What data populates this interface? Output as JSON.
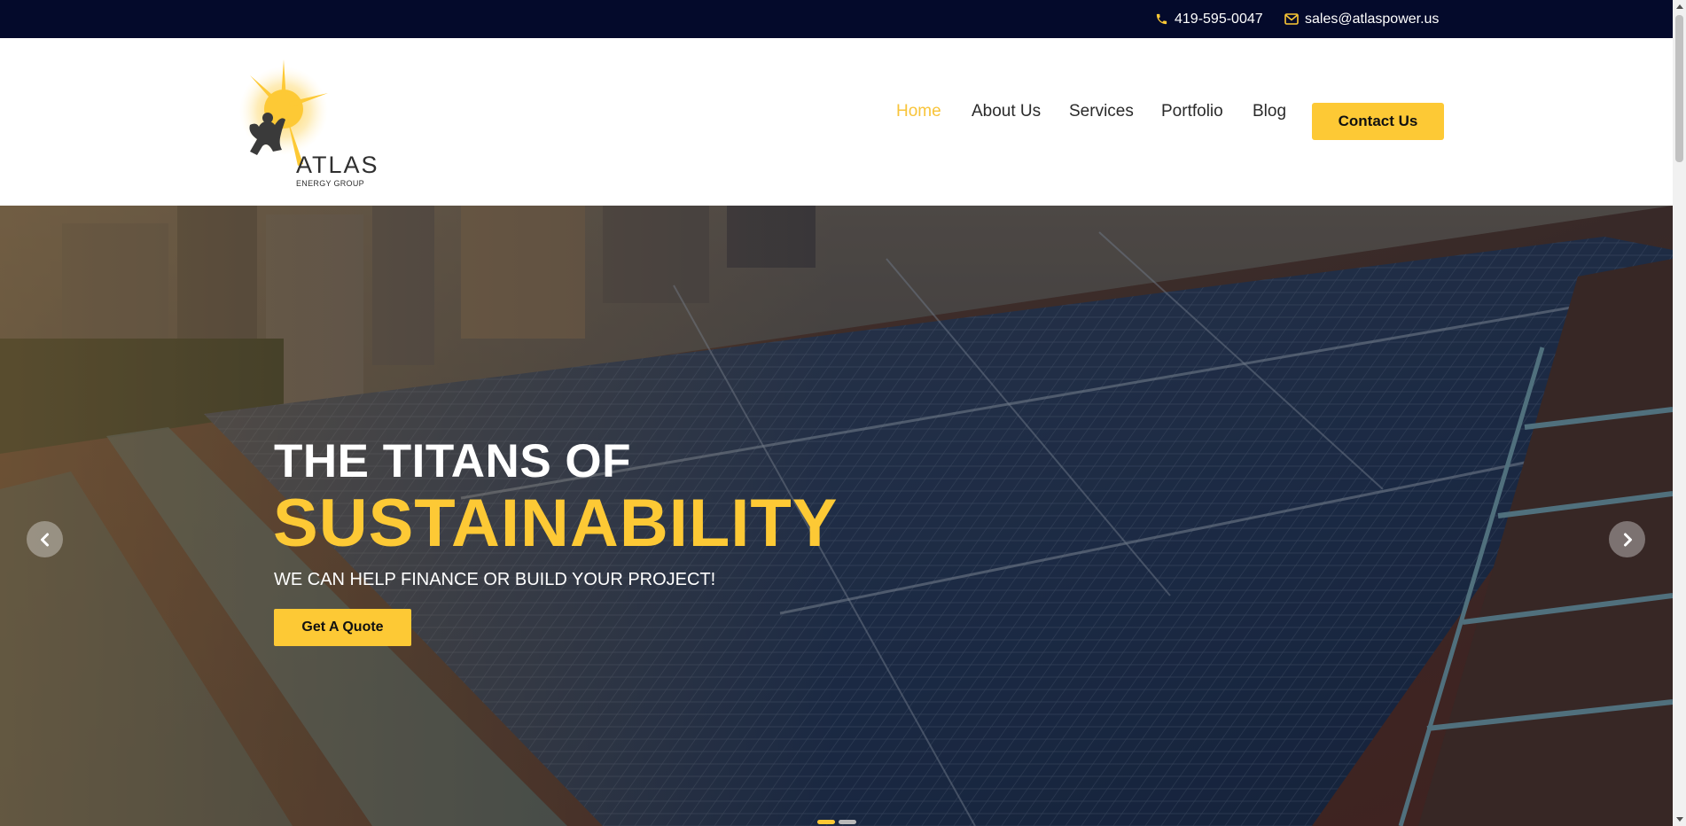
{
  "topbar": {
    "phone": "419-595-0047",
    "email": "sales@atlaspower.us",
    "background": "#040a2b",
    "icon_color": "#fdc935"
  },
  "header": {
    "logo": {
      "word": "ATLAS",
      "subtitle": "ENERGY GROUP"
    },
    "nav": [
      {
        "label": "Home",
        "active": true
      },
      {
        "label": "About Us",
        "active": false
      },
      {
        "label": "Services",
        "active": false
      },
      {
        "label": "Portfolio",
        "active": false
      },
      {
        "label": "Blog",
        "active": false
      }
    ],
    "contact_button": "Contact Us",
    "active_color": "#f8c43a"
  },
  "hero": {
    "line1": "THE TITANS OF",
    "line2": "SUSTAINABILITY",
    "tagline": "WE CAN HELP FINANCE OR BUILD YOUR PROJECT!",
    "cta": "Get A Quote",
    "accent": "#fdc935",
    "prev_icon": "chevron-left-icon",
    "next_icon": "chevron-right-icon",
    "slides_count": 2,
    "active_slide": 1
  }
}
